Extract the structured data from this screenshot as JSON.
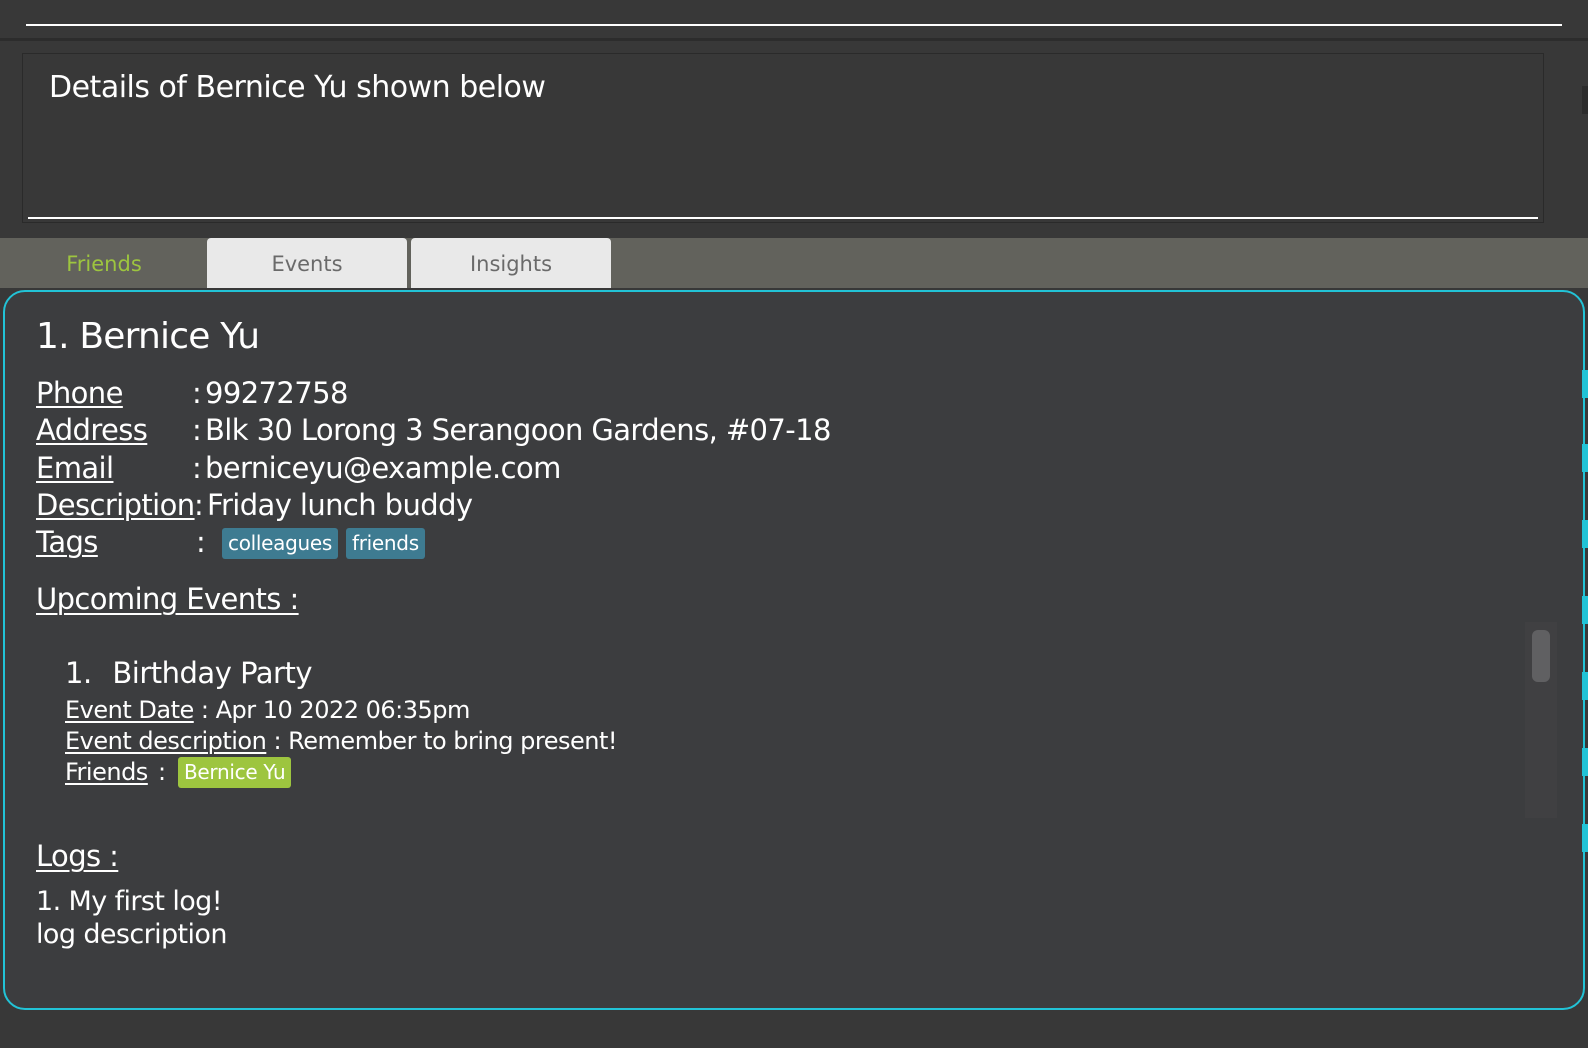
{
  "command_box": {
    "value": "",
    "placeholder": ""
  },
  "result_display": {
    "text": "Details of Bernice Yu shown below"
  },
  "tabs": [
    {
      "label": "Friends",
      "selected": true
    },
    {
      "label": "Events",
      "selected": false
    },
    {
      "label": "Insights",
      "selected": false
    }
  ],
  "friend": {
    "title": "1. Bernice Yu",
    "fields": {
      "phone": {
        "label": "Phone",
        "colon": ":",
        "value": "99272758"
      },
      "address": {
        "label": "Address",
        "colon": ":",
        "value": "Blk 30 Lorong 3 Serangoon Gardens, #07-18"
      },
      "email": {
        "label": "Email",
        "colon": ":",
        "value": "berniceyu@example.com"
      },
      "description": {
        "label": "Description",
        "colon": ":",
        "value": "Friday lunch buddy"
      },
      "tags": {
        "label": "Tags",
        "colon": ":",
        "values": [
          "colleagues",
          "friends"
        ]
      }
    },
    "upcoming_events_heading": "Upcoming Events :",
    "events": [
      {
        "index": "1.",
        "name": "Birthday Party",
        "date_label": "Event Date",
        "date_value": ": Apr 10 2022 06:35pm",
        "description_label": "Event description",
        "description_value": ": Remember to bring present!",
        "friends_label": "Friends",
        "friends_colon": ":",
        "friends": [
          "Bernice Yu"
        ]
      }
    ],
    "logs_heading": "Logs :",
    "logs": [
      {
        "title": "1. My first log!",
        "description": "log description"
      }
    ]
  },
  "colors": {
    "background": "#383838",
    "panel": "#3c3d3f",
    "panel_border": "#22c3d6",
    "tab_bar": "#62625c",
    "selected_tab_text": "#9dc53f",
    "tag_blue": "#3e7b91",
    "tag_green": "#9dc53f"
  }
}
